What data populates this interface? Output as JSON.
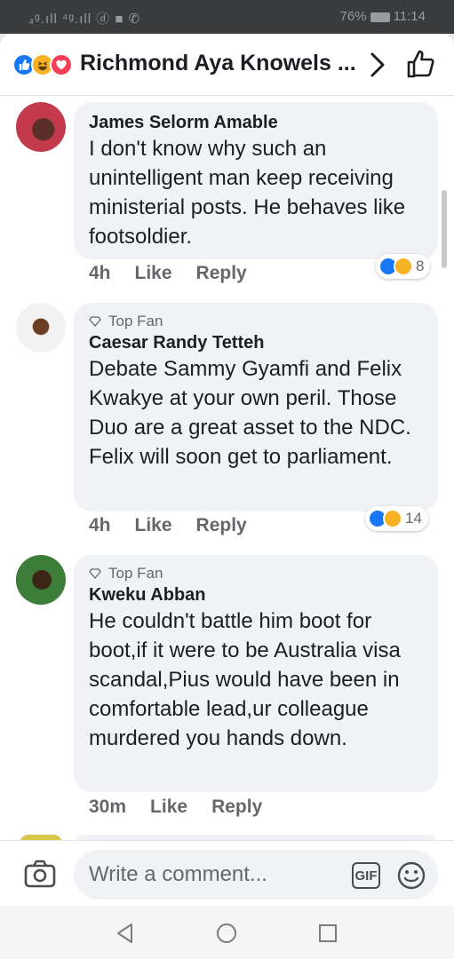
{
  "status_bar": {
    "left": "₄ᵍ.ıll ⁴ᵍ.ıll ⓓ ■ ✆",
    "battery": "76%",
    "time": "11:14"
  },
  "header": {
    "title": "Richmond Aya Knowels ...",
    "reactions": [
      "like",
      "haha",
      "love"
    ]
  },
  "comments": [
    {
      "author": "James Selorm Amable",
      "top_fan": "",
      "text": "I don't know why such an unintelligent man keep receiving ministerial posts. He behaves like footsoldier.",
      "time": "4h",
      "like": "Like",
      "reply": "Reply",
      "reaction_count": "8"
    },
    {
      "author": "Caesar Randy Tetteh",
      "top_fan": "Top Fan",
      "text": "Debate Sammy Gyamfi and Felix Kwakye at your own peril. Those Duo are a great asset to the NDC. Felix will soon get to parliament.",
      "time": "4h",
      "like": "Like",
      "reply": "Reply",
      "reaction_count": "14"
    },
    {
      "author": "Kweku Abban",
      "top_fan": "Top Fan",
      "text": "He couldn't battle him boot for boot,if it were to be Australia visa scandal,Pius would have been in comfortable lead,ur colleague murdered you hands down.",
      "time": "30m",
      "like": "Like",
      "reply": "Reply",
      "reaction_count": ""
    }
  ],
  "composer": {
    "placeholder": "Write a comment...",
    "gif": "GIF"
  },
  "colors": {
    "accent": "#1877f2",
    "haha": "#f7b125",
    "love": "#f33e58",
    "bubble": "#f0f2f5",
    "muted": "#65676b"
  }
}
